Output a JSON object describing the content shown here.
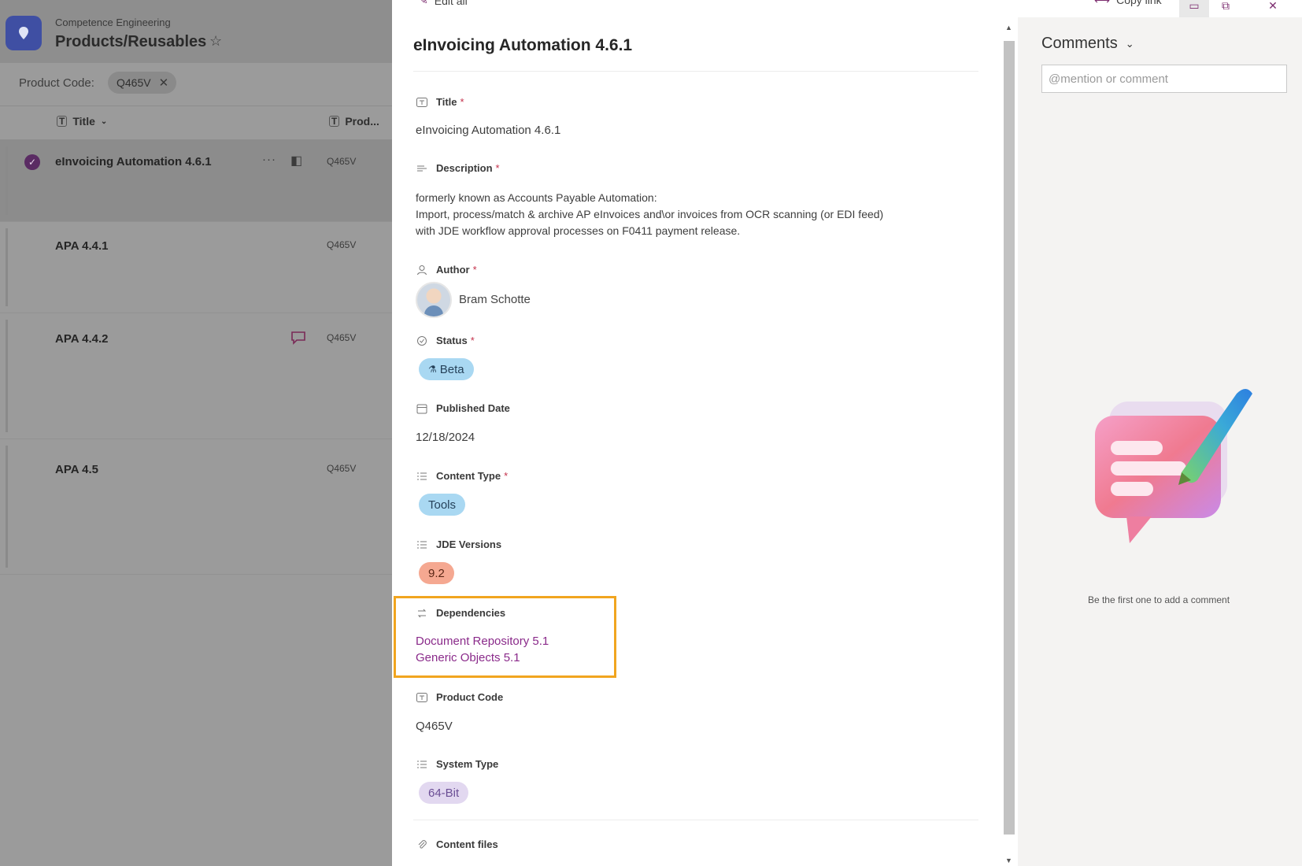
{
  "app": {
    "subtitle": "Competence Engineering",
    "title": "Products/Reusables"
  },
  "filter": {
    "label": "Product Code:",
    "chip": "Q465V"
  },
  "list": {
    "col_title": "Title",
    "col_prod": "Prod...",
    "rows": [
      {
        "title": "eInvoicing Automation 4.6.1",
        "code": "Q465V",
        "selected": true
      },
      {
        "title": "APA 4.4.1",
        "code": "Q465V"
      },
      {
        "title": "APA 4.4.2",
        "code": "Q465V"
      },
      {
        "title": "APA 4.5",
        "code": "Q465V"
      }
    ]
  },
  "toolbar": {
    "edit_all": "Edit all",
    "copy_link": "Copy link"
  },
  "form": {
    "title": "eInvoicing Automation 4.6.1",
    "fields": {
      "title_label": "Title",
      "title_value": "eInvoicing Automation 4.6.1",
      "description_label": "Description",
      "description_lines": [
        "formerly known as Accounts Payable Automation:",
        "Import, process/match & archive AP eInvoices and\\or invoices from OCR scanning (or EDI feed)",
        "with JDE workflow approval processes on F0411 payment release."
      ],
      "author_label": "Author",
      "author_name": "Bram Schotte",
      "status_label": "Status",
      "status_value": "Beta",
      "published_label": "Published Date",
      "published_value": "12/18/2024",
      "content_type_label": "Content Type",
      "content_type_value": "Tools",
      "jde_label": "JDE Versions",
      "jde_value": "9.2",
      "dependencies_label": "Dependencies",
      "dependencies": [
        "Document Repository 5.1",
        "Generic Objects 5.1"
      ],
      "product_code_label": "Product Code",
      "product_code_value": "Q465V",
      "system_type_label": "System Type",
      "system_type_value": "64-Bit",
      "content_files_label": "Content files"
    }
  },
  "comments": {
    "title": "Comments",
    "placeholder": "@mention or comment",
    "empty": "Be the first one to add a comment"
  },
  "colors": {
    "accent": "#7c2d6f",
    "highlight": "#f1a51f",
    "pill_blue": "#a9d8f2",
    "pill_salmon": "#f5a891",
    "pill_lavender": "#e2d8f0"
  }
}
